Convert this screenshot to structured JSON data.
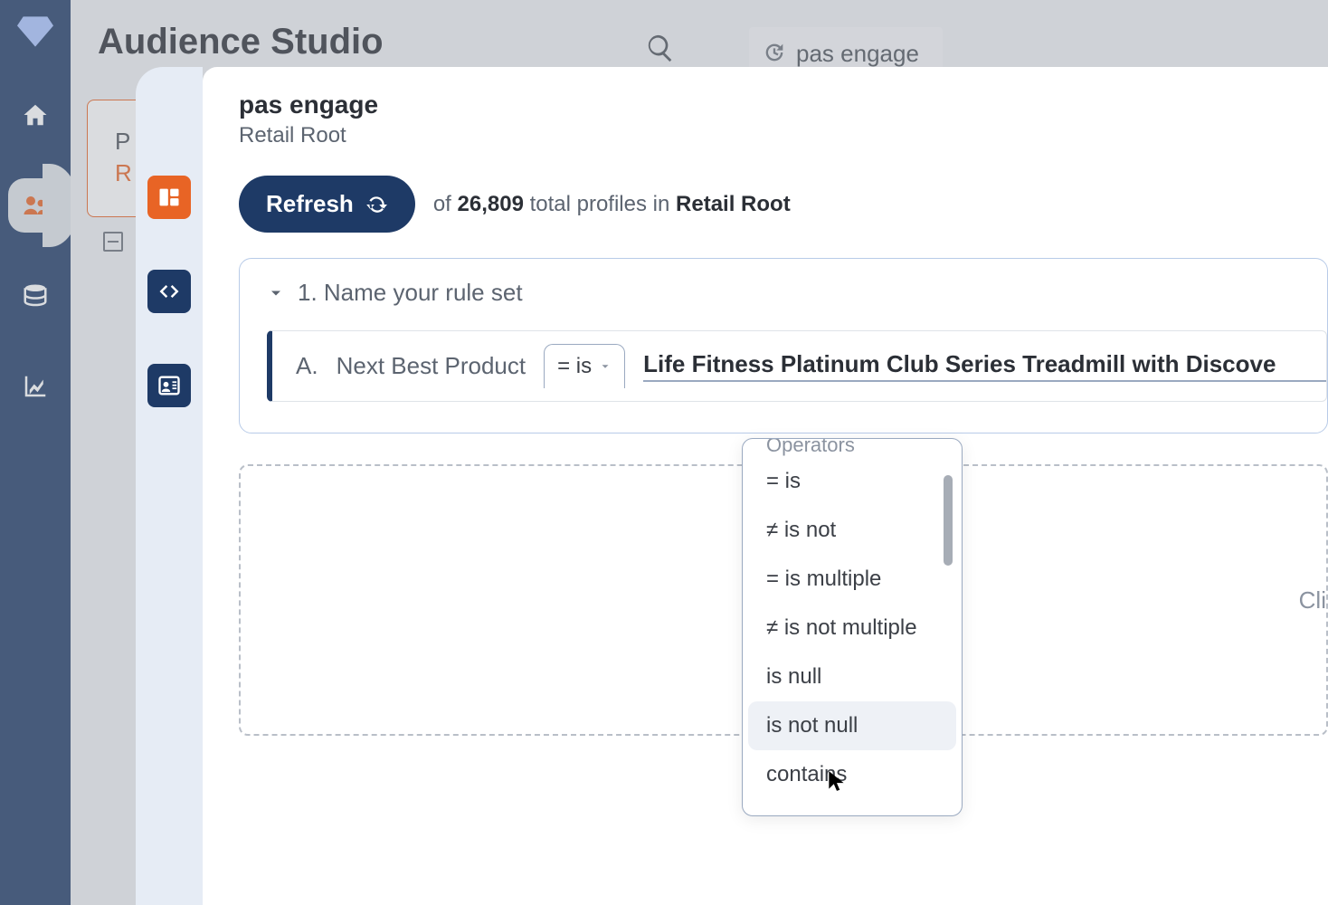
{
  "page": {
    "title": "Audience Studio"
  },
  "chip": {
    "label": "pas engage"
  },
  "sideCard": {
    "line1": "P",
    "line2": "R"
  },
  "modal": {
    "title": "pas engage",
    "breadcrumb": "Retail Root",
    "refresh": "Refresh",
    "profiles_prefix": "of ",
    "profiles_count": "26,809",
    "profiles_mid": " total profiles in ",
    "profiles_root": "Retail Root"
  },
  "ruleset": {
    "header": "1. Name your rule set",
    "row": {
      "letter": "A.",
      "attribute": "Next Best Product",
      "operator_display": "= is",
      "value": "Life Fitness Platinum Club Series Treadmill with Discove"
    }
  },
  "dropdown": {
    "title": "Operators",
    "items": [
      "= is",
      "≠ is not",
      "= is multiple",
      "≠ is not multiple",
      "is null",
      "is not null",
      "contains"
    ]
  },
  "dropzone": {
    "text": "Cli"
  }
}
